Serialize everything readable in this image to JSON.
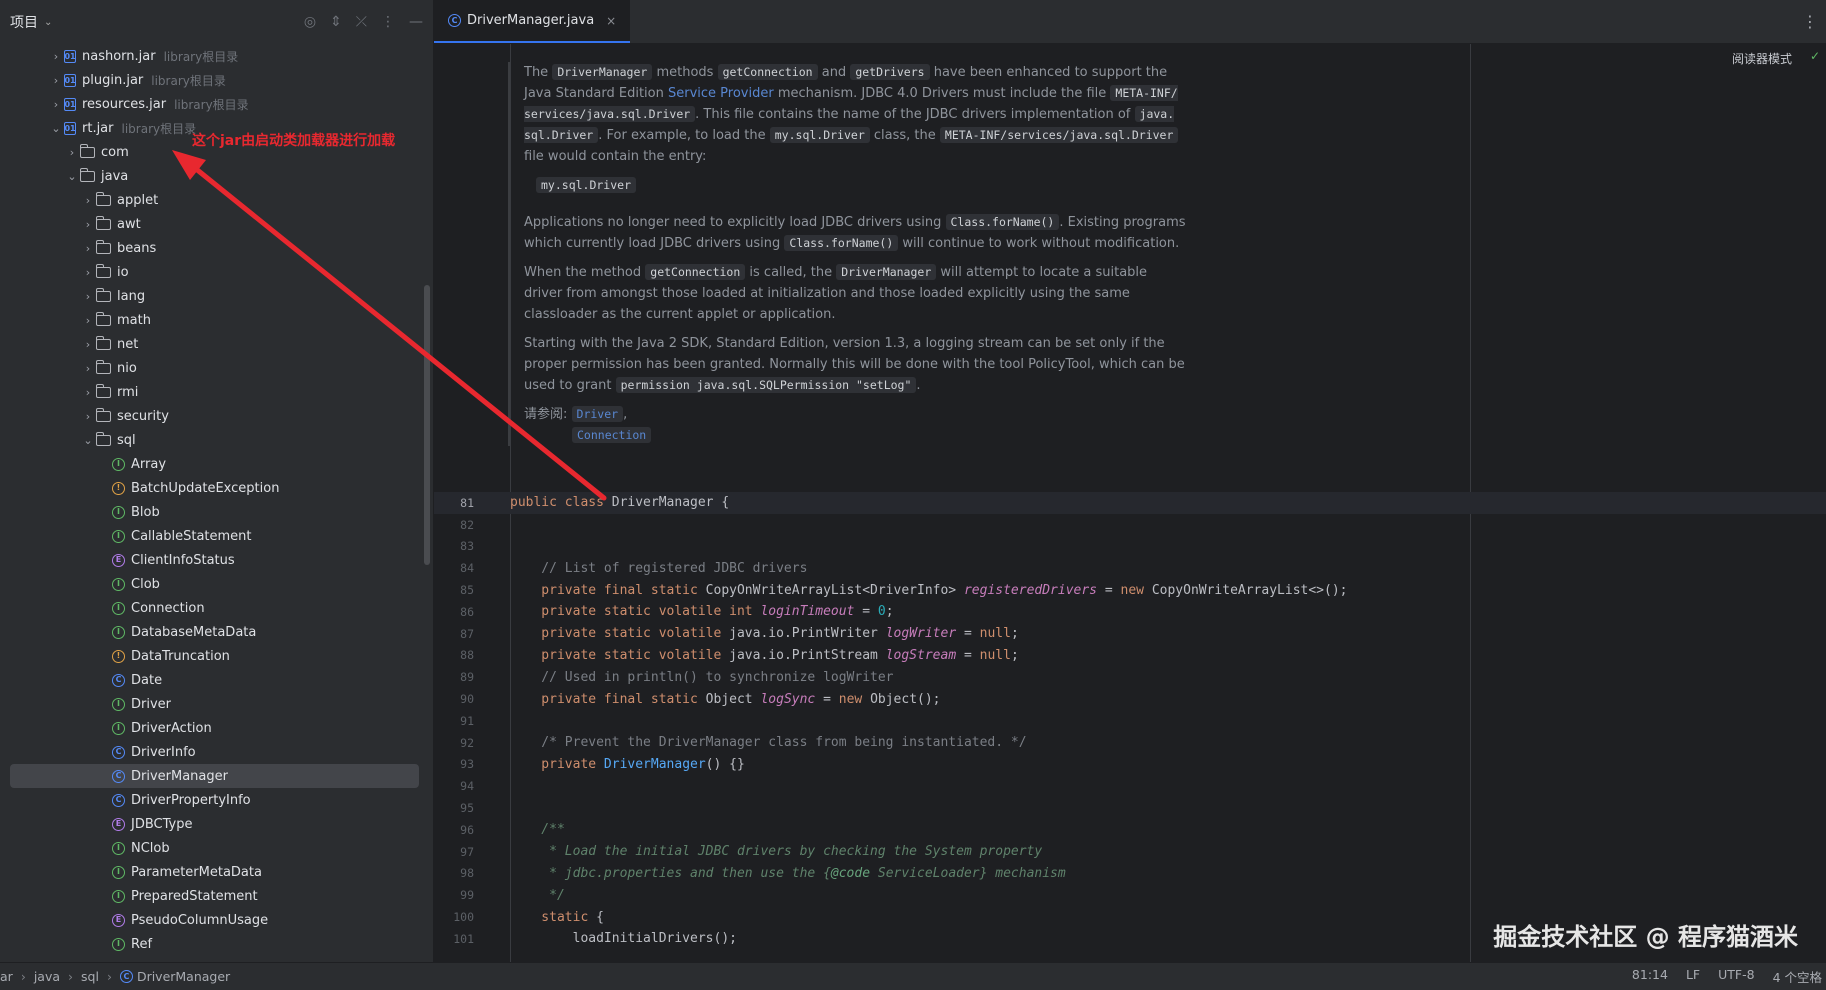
{
  "sidebar": {
    "title": "项目",
    "tree": [
      {
        "indent": 0,
        "chev": "›",
        "icon": "jar",
        "label": "nashorn.jar",
        "hint": "library根目录"
      },
      {
        "indent": 0,
        "chev": "›",
        "icon": "jar",
        "label": "plugin.jar",
        "hint": "library根目录"
      },
      {
        "indent": 0,
        "chev": "›",
        "icon": "jar",
        "label": "resources.jar",
        "hint": "library根目录"
      },
      {
        "indent": 0,
        "chev": "⌄",
        "icon": "jar",
        "label": "rt.jar",
        "hint": "library根目录"
      },
      {
        "indent": 1,
        "chev": "›",
        "icon": "folder",
        "label": "com",
        "hint": ""
      },
      {
        "indent": 1,
        "chev": "⌄",
        "icon": "folder",
        "label": "java",
        "hint": ""
      },
      {
        "indent": 2,
        "chev": "›",
        "icon": "folder",
        "label": "applet",
        "hint": ""
      },
      {
        "indent": 2,
        "chev": "›",
        "icon": "folder",
        "label": "awt",
        "hint": ""
      },
      {
        "indent": 2,
        "chev": "›",
        "icon": "folder",
        "label": "beans",
        "hint": ""
      },
      {
        "indent": 2,
        "chev": "›",
        "icon": "folder",
        "label": "io",
        "hint": ""
      },
      {
        "indent": 2,
        "chev": "›",
        "icon": "folder",
        "label": "lang",
        "hint": ""
      },
      {
        "indent": 2,
        "chev": "›",
        "icon": "folder",
        "label": "math",
        "hint": ""
      },
      {
        "indent": 2,
        "chev": "›",
        "icon": "folder",
        "label": "net",
        "hint": ""
      },
      {
        "indent": 2,
        "chev": "›",
        "icon": "folder",
        "label": "nio",
        "hint": ""
      },
      {
        "indent": 2,
        "chev": "›",
        "icon": "folder",
        "label": "rmi",
        "hint": ""
      },
      {
        "indent": 2,
        "chev": "›",
        "icon": "folder",
        "label": "security",
        "hint": ""
      },
      {
        "indent": 2,
        "chev": "⌄",
        "icon": "folder",
        "label": "sql",
        "hint": ""
      },
      {
        "indent": 3,
        "chev": "",
        "icon": "interface",
        "label": "Array",
        "hint": ""
      },
      {
        "indent": 3,
        "chev": "",
        "icon": "exception",
        "label": "BatchUpdateException",
        "hint": ""
      },
      {
        "indent": 3,
        "chev": "",
        "icon": "interface",
        "label": "Blob",
        "hint": ""
      },
      {
        "indent": 3,
        "chev": "",
        "icon": "interface",
        "label": "CallableStatement",
        "hint": ""
      },
      {
        "indent": 3,
        "chev": "",
        "icon": "enum",
        "label": "ClientInfoStatus",
        "hint": ""
      },
      {
        "indent": 3,
        "chev": "",
        "icon": "interface",
        "label": "Clob",
        "hint": ""
      },
      {
        "indent": 3,
        "chev": "",
        "icon": "interface",
        "label": "Connection",
        "hint": ""
      },
      {
        "indent": 3,
        "chev": "",
        "icon": "interface",
        "label": "DatabaseMetaData",
        "hint": ""
      },
      {
        "indent": 3,
        "chev": "",
        "icon": "exception",
        "label": "DataTruncation",
        "hint": ""
      },
      {
        "indent": 3,
        "chev": "",
        "icon": "class",
        "label": "Date",
        "hint": ""
      },
      {
        "indent": 3,
        "chev": "",
        "icon": "interface",
        "label": "Driver",
        "hint": ""
      },
      {
        "indent": 3,
        "chev": "",
        "icon": "interface",
        "label": "DriverAction",
        "hint": ""
      },
      {
        "indent": 3,
        "chev": "",
        "icon": "class",
        "label": "DriverInfo",
        "hint": ""
      },
      {
        "indent": 3,
        "chev": "",
        "icon": "class",
        "label": "DriverManager",
        "hint": "",
        "selected": true
      },
      {
        "indent": 3,
        "chev": "",
        "icon": "class",
        "label": "DriverPropertyInfo",
        "hint": ""
      },
      {
        "indent": 3,
        "chev": "",
        "icon": "enum",
        "label": "JDBCType",
        "hint": ""
      },
      {
        "indent": 3,
        "chev": "",
        "icon": "interface",
        "label": "NClob",
        "hint": ""
      },
      {
        "indent": 3,
        "chev": "",
        "icon": "interface",
        "label": "ParameterMetaData",
        "hint": ""
      },
      {
        "indent": 3,
        "chev": "",
        "icon": "interface",
        "label": "PreparedStatement",
        "hint": ""
      },
      {
        "indent": 3,
        "chev": "",
        "icon": "enum",
        "label": "PseudoColumnUsage",
        "hint": ""
      },
      {
        "indent": 3,
        "chev": "",
        "icon": "interface",
        "label": "Ref",
        "hint": ""
      }
    ]
  },
  "annotation": {
    "text": "这个jar由启动类加载器进行加载",
    "color": "#e8282f"
  },
  "editor": {
    "tab_label": "DriverManager.java",
    "tab_close": "×",
    "reader_mode": "阅读器模式",
    "doc": {
      "p1": [
        "The ",
        "DriverManager",
        " methods ",
        "getConnection",
        " and ",
        "getDrivers",
        " have been enhanced to support the Java Standard Edition ",
        "Service Provider",
        " mechanism. JDBC 4.0 Drivers must include the file ",
        "META-INF/ services/java.sql.Driver",
        ". This file contains the name of the JDBC drivers implementation of ",
        "java. sql.Driver",
        ". For example, to load the ",
        "my.sql.Driver",
        " class, the ",
        "META-INF/services/java.sql.Driver",
        " file would contain the entry:"
      ],
      "example": "my.sql.Driver",
      "p2": [
        "Applications no longer need to explicitly load JDBC drivers using ",
        "Class.forName()",
        ". Existing programs which currently load JDBC drivers using ",
        "Class.forName()",
        " will continue to work without modification."
      ],
      "p3": [
        "When the method ",
        "getConnection",
        " is called, the ",
        "DriverManager",
        " will attempt to locate a suitable driver from amongst those loaded at initialization and those loaded explicitly using the same classloader as the current applet or application."
      ],
      "p4": [
        "Starting with the Java 2 SDK, Standard Edition, version 1.3, a logging stream can be set only if the proper permission has been granted. Normally this will be done with the tool PolicyTool, which can be used to grant ",
        "permission java.sql.SQLPermission \"setLog\"",
        "."
      ],
      "see_also_label": "请参阅:",
      "see_also": [
        "Driver",
        "Connection"
      ]
    },
    "code_lines": [
      {
        "n": "81",
        "current": true,
        "parts": [
          [
            "kw",
            "public class "
          ],
          [
            "cls",
            "DriverManager"
          ],
          [
            "normal",
            " {"
          ]
        ]
      },
      {
        "n": "82",
        "parts": []
      },
      {
        "n": "83",
        "parts": []
      },
      {
        "n": "84",
        "parts": [
          [
            "cm",
            "    // List of registered JDBC drivers"
          ]
        ]
      },
      {
        "n": "85",
        "parts": [
          [
            "kw",
            "    private final static "
          ],
          [
            "normal",
            "CopyOnWriteArrayList<DriverInfo> "
          ],
          [
            "fld",
            "registeredDrivers"
          ],
          [
            "normal",
            " = "
          ],
          [
            "kw",
            "new "
          ],
          [
            "normal",
            "CopyOnWriteArrayList<>();"
          ]
        ]
      },
      {
        "n": "86",
        "parts": [
          [
            "kw",
            "    private static volatile int "
          ],
          [
            "fld",
            "loginTimeout"
          ],
          [
            "normal",
            " = "
          ],
          [
            "num",
            "0"
          ],
          [
            "normal",
            ";"
          ]
        ]
      },
      {
        "n": "87",
        "parts": [
          [
            "kw",
            "    private static volatile "
          ],
          [
            "normal",
            "java.io.PrintWriter "
          ],
          [
            "fld",
            "logWriter"
          ],
          [
            "normal",
            " = "
          ],
          [
            "kw",
            "null"
          ],
          [
            "normal",
            ";"
          ]
        ]
      },
      {
        "n": "88",
        "parts": [
          [
            "kw",
            "    private static volatile "
          ],
          [
            "normal",
            "java.io.PrintStream "
          ],
          [
            "fld",
            "logStream"
          ],
          [
            "normal",
            " = "
          ],
          [
            "kw",
            "null"
          ],
          [
            "normal",
            ";"
          ]
        ]
      },
      {
        "n": "89",
        "parts": [
          [
            "cm",
            "    // Used in println() to synchronize logWriter"
          ]
        ]
      },
      {
        "n": "90",
        "parts": [
          [
            "kw",
            "    private final static "
          ],
          [
            "normal",
            "Object "
          ],
          [
            "fld",
            "logSync"
          ],
          [
            "normal",
            " = "
          ],
          [
            "kw",
            "new "
          ],
          [
            "normal",
            "Object();"
          ]
        ]
      },
      {
        "n": "91",
        "parts": []
      },
      {
        "n": "92",
        "parts": [
          [
            "cm",
            "    /* Prevent the DriverManager class from being instantiated. */"
          ]
        ]
      },
      {
        "n": "93",
        "parts": [
          [
            "kw",
            "    private "
          ],
          [
            "mtd",
            "DriverManager"
          ],
          [
            "normal",
            "() {}"
          ]
        ]
      },
      {
        "n": "94",
        "parts": []
      },
      {
        "n": "95",
        "parts": []
      },
      {
        "n": "96",
        "parts": [
          [
            "doccm",
            "    /**"
          ]
        ]
      },
      {
        "n": "97",
        "parts": [
          [
            "doccm",
            "     * Load the initial JDBC drivers by checking the System property"
          ]
        ]
      },
      {
        "n": "98",
        "parts": [
          [
            "doccm",
            "     * jdbc.properties and then use the {"
          ],
          [
            "tag",
            "@code"
          ],
          [
            "doccm",
            " ServiceLoader} mechanism"
          ]
        ]
      },
      {
        "n": "99",
        "parts": [
          [
            "doccm",
            "     */"
          ]
        ]
      },
      {
        "n": "100",
        "parts": [
          [
            "kw",
            "    static "
          ],
          [
            "normal",
            "{"
          ]
        ]
      },
      {
        "n": "101",
        "parts": [
          [
            "normal",
            "        loadInitialDrivers();"
          ]
        ]
      }
    ]
  },
  "statusbar": {
    "crumbs": [
      "ar",
      "java",
      "sql",
      "DriverManager"
    ],
    "position": "81:14",
    "line_sep": "LF",
    "encoding": "UTF-8",
    "indent": "4 个空格"
  },
  "watermark": "掘金技术社区 @ 程序猫酒米",
  "colors": {
    "accent": "#3574f0",
    "annotation_red": "#e8282f"
  }
}
